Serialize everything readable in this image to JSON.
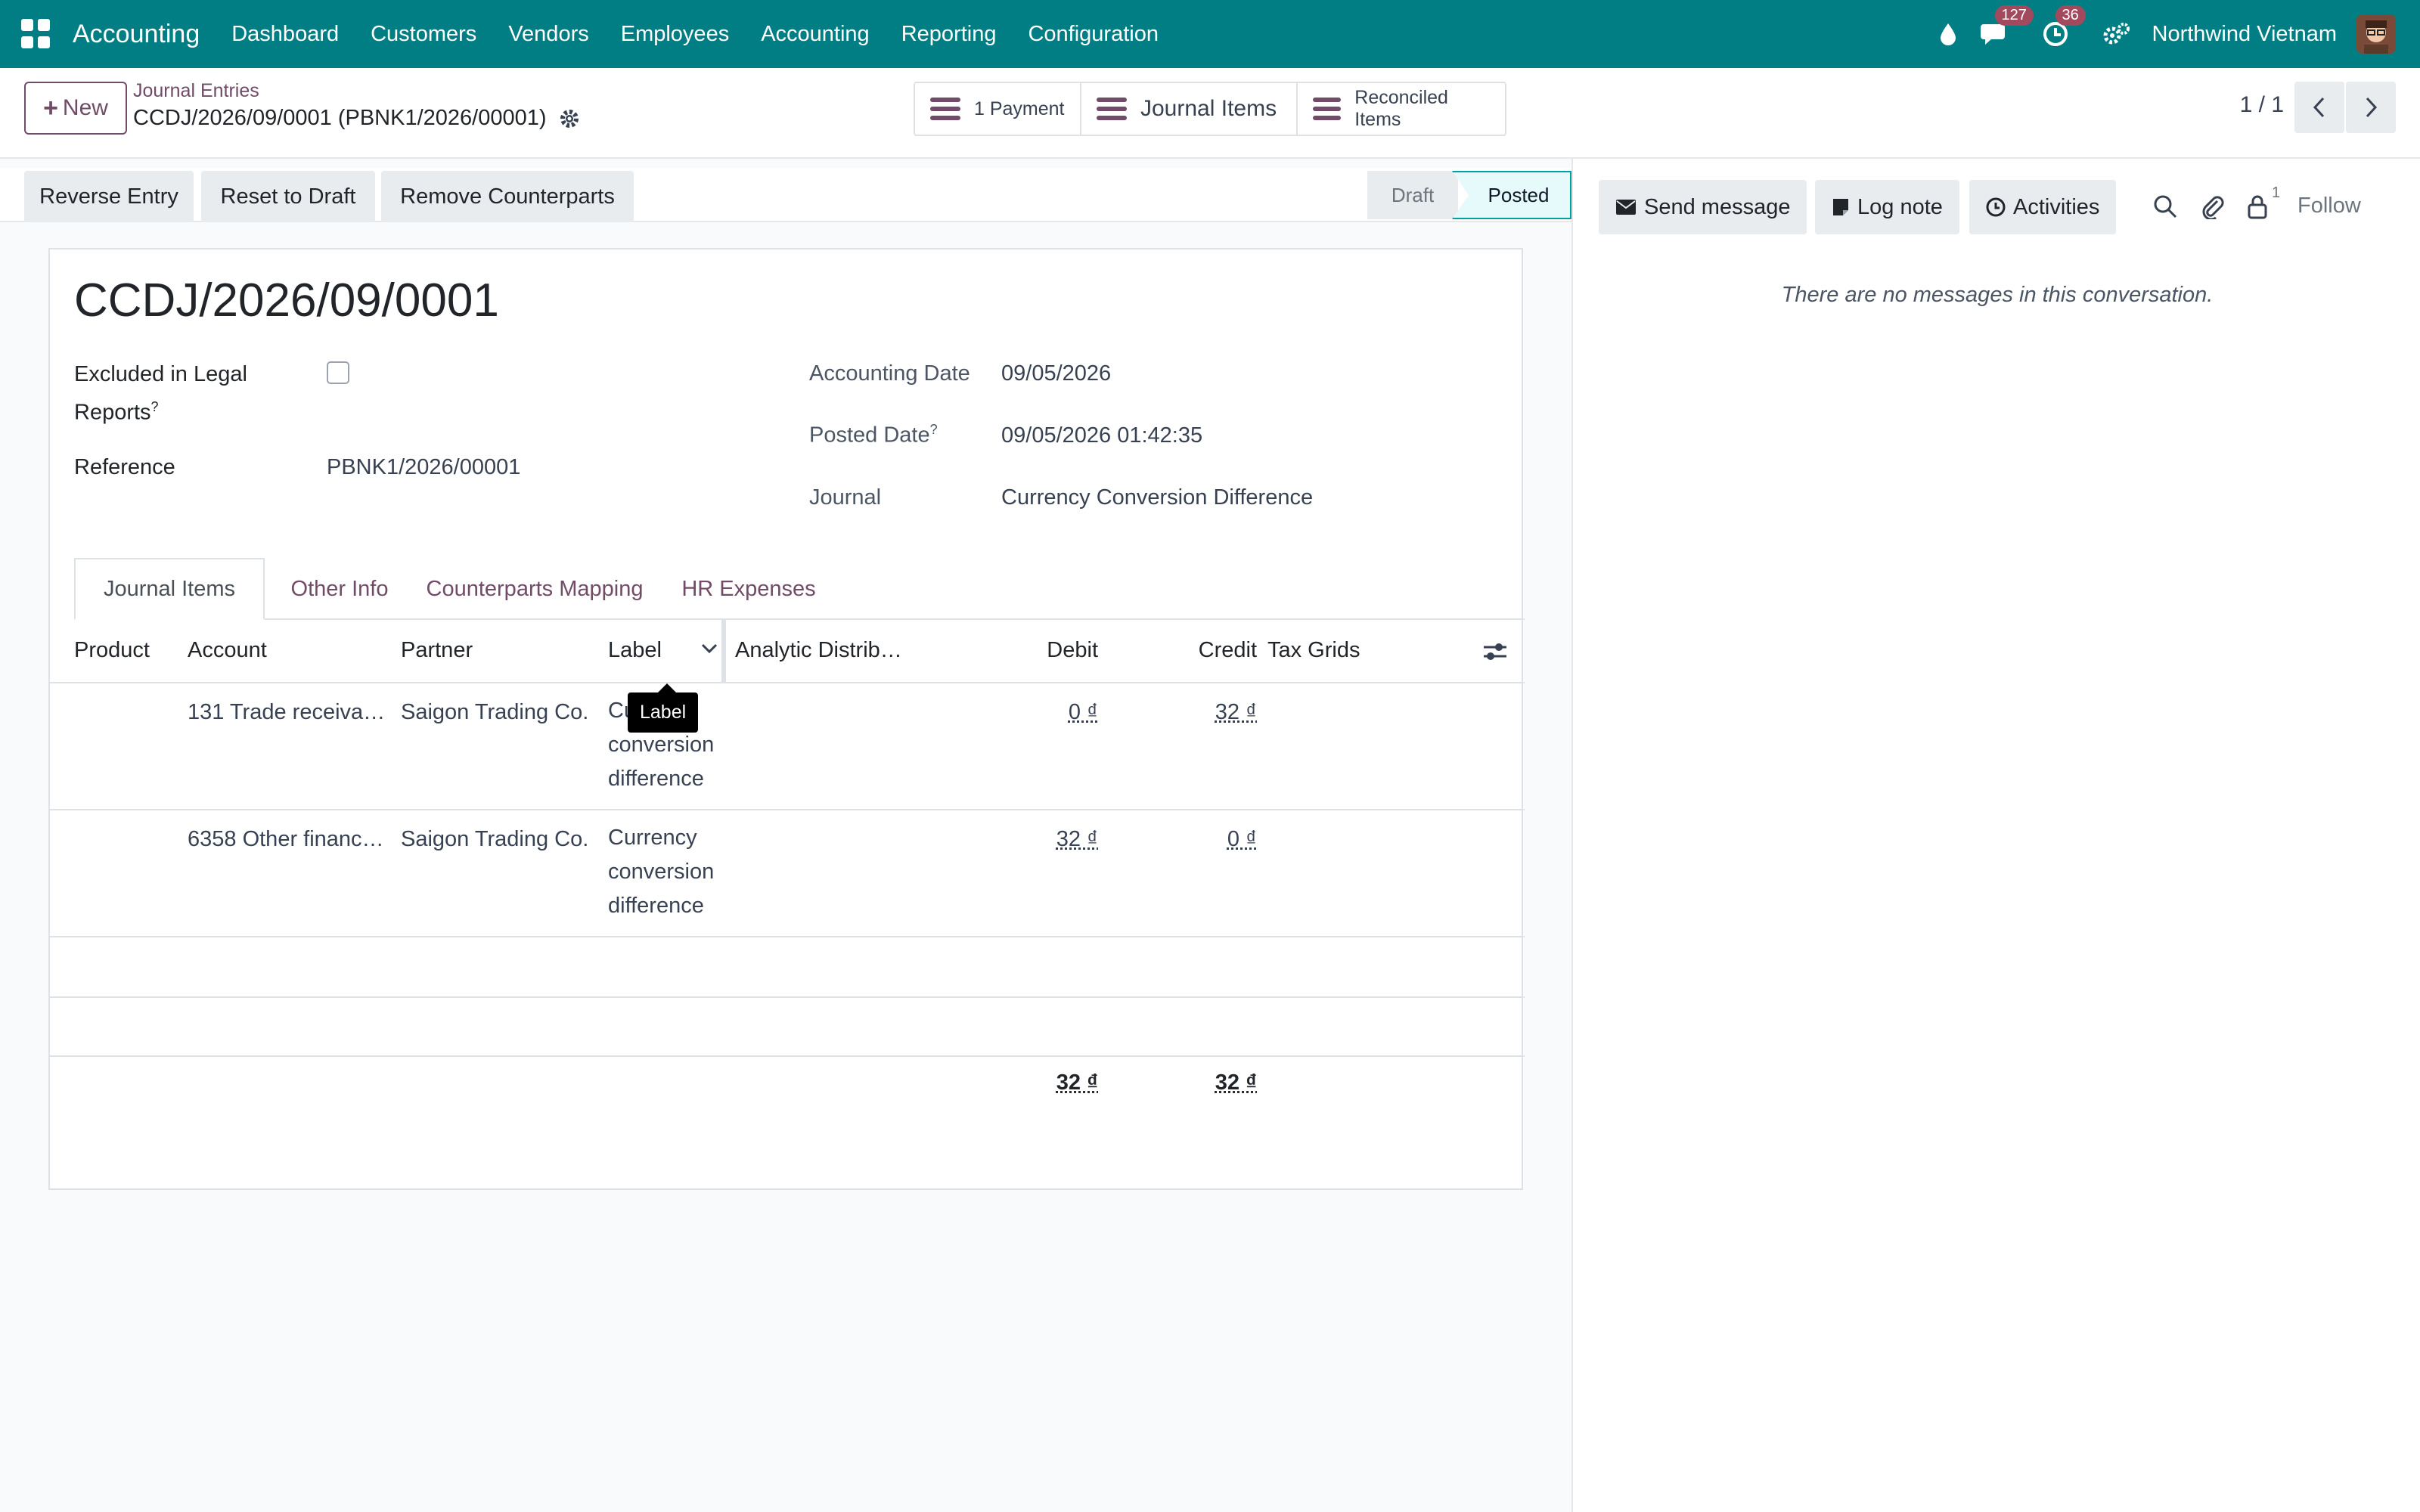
{
  "topbar": {
    "app_name": "Accounting",
    "menu": [
      "Dashboard",
      "Customers",
      "Vendors",
      "Employees",
      "Accounting",
      "Reporting",
      "Configuration"
    ],
    "messages_badge": "127",
    "activities_badge": "36",
    "company": "Northwind Vietnam",
    "icons": [
      "apps-icon",
      "droplet-icon",
      "chat-icon",
      "clock-icon",
      "settings-icon",
      "avatar"
    ]
  },
  "control_panel": {
    "new_label": "New",
    "breadcrumb_parent": "Journal Entries",
    "breadcrumb_current": "CCDJ/2026/09/0001 (PBNK1/2026/00001)",
    "smart_buttons": [
      "1 Payment",
      "Journal Items",
      "Reconciled Items"
    ],
    "pager": "1 / 1"
  },
  "status_bar": {
    "actions": [
      "Reverse Entry",
      "Reset to Draft",
      "Remove Counterparts"
    ],
    "stages": [
      "Draft",
      "Posted"
    ],
    "current_stage": "Posted"
  },
  "form": {
    "title": "CCDJ/2026/09/0001",
    "excluded_label": "Excluded in Legal Reports",
    "excluded_checked": false,
    "reference_label": "Reference",
    "reference_value": "PBNK1/2026/00001",
    "accounting_date_label": "Accounting Date",
    "accounting_date_value": "09/05/2026",
    "posted_date_label": "Posted Date",
    "posted_date_value": "09/05/2026 01:42:35",
    "journal_label": "Journal",
    "journal_value": "Currency Conversion Difference",
    "help_mark": "?"
  },
  "tabs": [
    "Journal Items",
    "Other Info",
    "Counterparts Mapping",
    "HR Expenses"
  ],
  "active_tab": "Journal Items",
  "table": {
    "columns": [
      "Product",
      "Account",
      "Partner",
      "Label",
      "Analytic Distrib…",
      "Debit",
      "Credit",
      "Tax Grids"
    ],
    "rows": [
      {
        "product": "",
        "account": "131 Trade receiva…",
        "partner": "Saigon Trading Co.",
        "label": "Currency conversion difference",
        "analytic": "",
        "debit": "0 ₫",
        "credit": "32 ₫",
        "tax_grids": ""
      },
      {
        "product": "",
        "account": "6358 Other financ…",
        "partner": "Saigon Trading Co.",
        "label": "Currency conversion difference",
        "analytic": "",
        "debit": "32 ₫",
        "credit": "0 ₫",
        "tax_grids": ""
      }
    ],
    "total_debit": "32 ₫",
    "total_credit": "32 ₫",
    "tooltip": "Label"
  },
  "chatter": {
    "send_message": "Send message",
    "log_note": "Log note",
    "activities": "Activities",
    "followers_count": "1",
    "follow": "Follow",
    "empty": "There are no messages in this conversation."
  }
}
